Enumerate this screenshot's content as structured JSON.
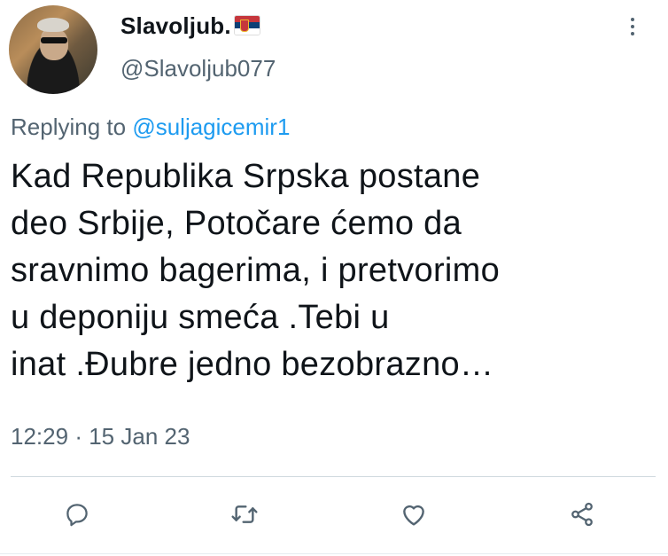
{
  "author": {
    "display_name": "Slavoljub.",
    "handle": "@Slavoljub077",
    "flag_icon": "serbia-flag-icon"
  },
  "reply": {
    "prefix": "Replying to ",
    "mention": "@suljagicemir1"
  },
  "tweet": {
    "text": "Kad Republika Srpska postane\ndeo Srbije, Potočare ćemo da\nsravnimo bagerima, i pretvorimo\nu deponiju smeća .Tebi u\ninat  .Đubre jedno bezobrazno…",
    "time": "12:29",
    "separator": "·",
    "date": "15 Jan 23"
  },
  "actions": {
    "icons": [
      "reply-icon",
      "retweet-icon",
      "like-icon",
      "share-icon"
    ],
    "icon_color": "#536471"
  },
  "colors": {
    "accent": "#1d9bf0",
    "secondary_text": "#536471"
  }
}
